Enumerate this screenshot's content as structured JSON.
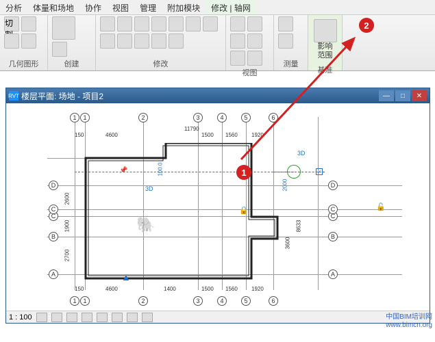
{
  "tabs": [
    "分析",
    "体量和场地",
    "协作",
    "视图",
    "管理",
    "附加模块",
    "修改 | 轴网"
  ],
  "active_tab": 6,
  "ribbon": {
    "g0": "几何图形",
    "g1": "创建",
    "g2": "修改",
    "g3": "视图",
    "g4": "测量",
    "g5": "基准",
    "basis_vert": "影响\n范围"
  },
  "doc": {
    "title": "楼层平面: 场地 - 项目2",
    "rvt": "RVT"
  },
  "grid": {
    "cols": [
      "1",
      "2",
      "3",
      "4",
      "5",
      "6"
    ],
    "rows": [
      "A",
      "B",
      "C",
      "D"
    ],
    "dims_top": [
      "150",
      "4600",
      "11790",
      "1500",
      "1560",
      "1920"
    ],
    "dims_mid": [
      "1400",
      "100.0",
      "2000"
    ],
    "dims_left": [
      "2700",
      "1900",
      "2600"
    ],
    "dims_right": [
      "3600",
      "8633"
    ],
    "label_3d1": "3D",
    "label_3d2": "3D"
  },
  "status": {
    "scale": "1 : 100"
  },
  "watermark": {
    "l1": "中国BIM培训网",
    "l2": "www.bimcn.org"
  },
  "annot": {
    "n1": "1",
    "n2": "2"
  }
}
